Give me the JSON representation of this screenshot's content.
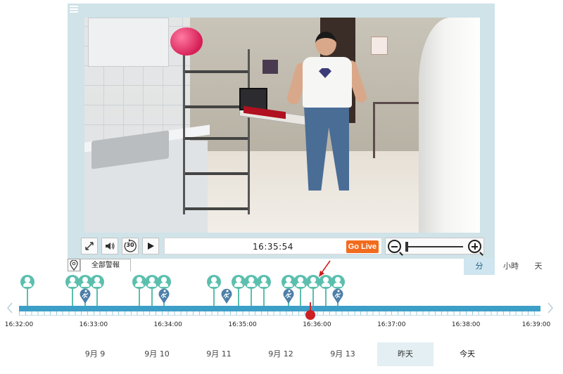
{
  "player": {
    "menu_icon": "menu-icon",
    "current_time": "16:35:54",
    "go_live_label": "Go Live",
    "rewind_label": "30",
    "controls": [
      "fullscreen-icon",
      "volume-icon",
      "rewind-30-icon",
      "play-icon"
    ],
    "zoom_level": 0.0
  },
  "filter": {
    "location_icon": "location-pin-icon",
    "tab_label": "全部警報"
  },
  "units": {
    "minute": "分",
    "hour": "小時",
    "day": "天",
    "selected": "分"
  },
  "timeline": {
    "labels": [
      "16:32:00",
      "16:33:00",
      "16:34:00",
      "16:35:00",
      "16:36:00",
      "16:37:00",
      "16:38:00",
      "16:39:00"
    ],
    "playhead_time": "16:35:54",
    "colors": {
      "bar": "#3c9fc7",
      "person_event": "#5bbfae",
      "motion_event": "#4d7fa8",
      "playhead": "#cc2024"
    },
    "person_events": [
      "16:32:07",
      "16:32:43",
      "16:32:53",
      "16:33:03",
      "16:33:37",
      "16:33:47",
      "16:33:57",
      "16:34:37",
      "16:34:57",
      "16:35:07",
      "16:35:17",
      "16:35:37",
      "16:35:47",
      "16:35:57",
      "16:36:07",
      "16:36:17"
    ],
    "motion_events": [
      "16:32:53",
      "16:33:57",
      "16:34:47",
      "16:35:37",
      "16:36:17"
    ]
  },
  "dates": [
    "9月 9",
    "9月 10",
    "9月 11",
    "9月 12",
    "9月 13",
    "昨天",
    "今天"
  ],
  "selected_date": "昨天"
}
